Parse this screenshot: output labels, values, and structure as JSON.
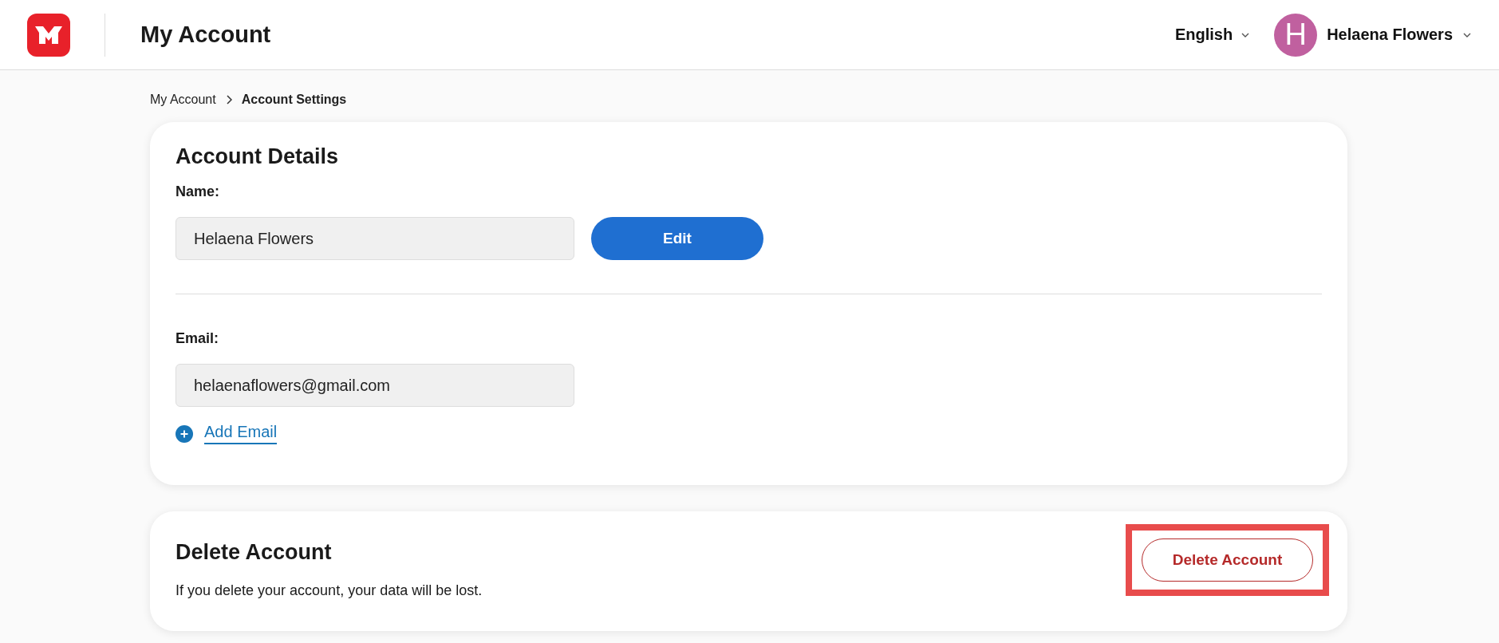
{
  "header": {
    "title": "My Account",
    "language": "English",
    "user": {
      "initial": "H",
      "name": "Helaena Flowers"
    }
  },
  "breadcrumb": [
    {
      "label": "My Account",
      "current": false
    },
    {
      "label": "Account Settings",
      "current": true
    }
  ],
  "account_details": {
    "title": "Account Details",
    "name_label": "Name:",
    "name_value": "Helaena Flowers",
    "edit_button": "Edit",
    "email_label": "Email:",
    "email_value": "helaenaflowers@gmail.com",
    "add_email": "Add Email"
  },
  "delete_account": {
    "title": "Delete Account",
    "description": "If you delete your account, your data will be lost.",
    "button": "Delete Account",
    "highlighted": true
  }
}
